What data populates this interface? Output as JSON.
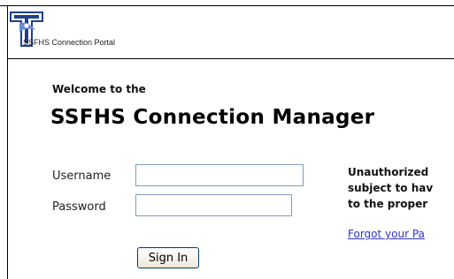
{
  "header": {
    "portal_name": "SSFHS Connection Portal",
    "logo_icon": "ssfhs-cross-logo-icon"
  },
  "main": {
    "welcome": "Welcome to the",
    "title": "SSFHS Connection Manager"
  },
  "form": {
    "username_label": "Username",
    "username_value": "",
    "password_label": "Password",
    "password_value": "",
    "signin_label": "Sign In"
  },
  "notice": {
    "text": "Unauthorized\nsubject to hav\nto the proper"
  },
  "links": {
    "forgot": "Forgot your Pa"
  },
  "colors": {
    "link": "#3333cc",
    "logo_blue": "#1f3f8f",
    "input_border": "#7f9db9"
  }
}
